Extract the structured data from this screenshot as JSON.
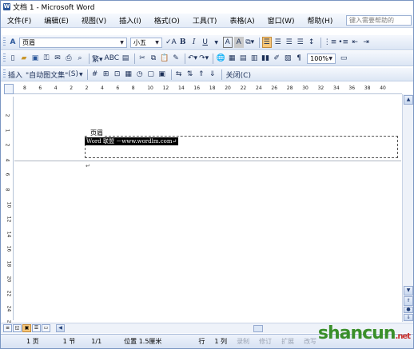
{
  "window": {
    "title": "文档 1 - Microsoft Word"
  },
  "menu": {
    "items": [
      "文件(F)",
      "编辑(E)",
      "视图(V)",
      "插入(I)",
      "格式(O)",
      "工具(T)",
      "表格(A)",
      "窗口(W)",
      "帮助(H)"
    ],
    "help_placeholder": "键入需要帮助的"
  },
  "format_toolbar": {
    "style_value": "页眉",
    "size_value": "小五",
    "bold": "B",
    "italic": "I",
    "underline": "U",
    "font_a": "A",
    "font_a2": "A"
  },
  "standard_toolbar": {
    "zoom_value": "100%"
  },
  "header_footer_toolbar": {
    "insert_label": "插入",
    "autotext_label": "\"自动图文集\"",
    "autotext_hotkey": "(S)",
    "close_label": "关闭(C)"
  },
  "ruler": {
    "h_ticks": [
      "8",
      "6",
      "4",
      "2",
      "2",
      "4",
      "6",
      "8",
      "10",
      "12",
      "14",
      "16",
      "18",
      "20",
      "22",
      "24",
      "26",
      "28",
      "30",
      "32",
      "34",
      "36",
      "38",
      "40"
    ],
    "v_ticks": [
      "2",
      "1",
      "2",
      "4",
      "6",
      "8",
      "10",
      "12",
      "14",
      "16",
      "18",
      "20",
      "22",
      "24",
      "26"
    ]
  },
  "document": {
    "header_label": "页眉",
    "header_text": "Word 联盟 －www.wordlm.com",
    "paragraph_mark": "↵"
  },
  "status": {
    "page": "1 页",
    "section": "1 节",
    "page_of": "1/1",
    "position": "位置 1.5厘米",
    "line": "行",
    "column": "1 列",
    "rec": "录制",
    "trk": "修订",
    "ext": "扩展",
    "ovr": "改写"
  },
  "watermark": {
    "text": "shancun",
    "suffix": ".net"
  }
}
